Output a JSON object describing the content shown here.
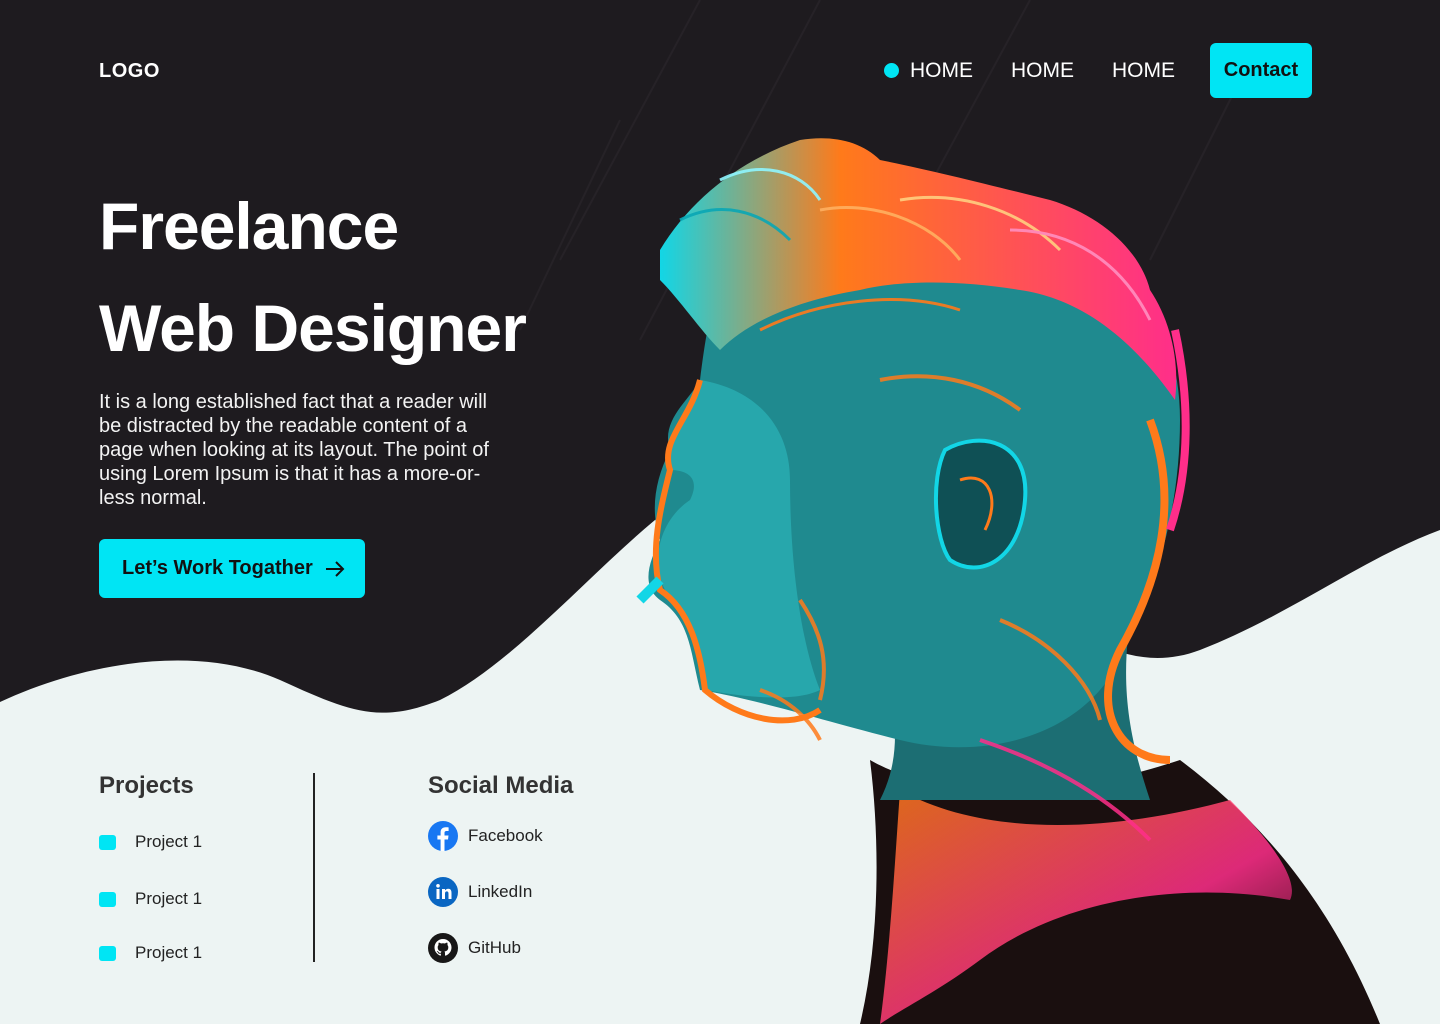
{
  "header": {
    "logo": "LOGO",
    "nav": [
      "HOME",
      "HOME",
      "HOME"
    ],
    "contact_label": "Contact"
  },
  "hero": {
    "title_line1": "Freelance",
    "title_line2": "Web Designer",
    "description": "It is a long established fact that a reader will be distracted by the readable content of a page when looking at its layout. The point of using Lorem Ipsum is that it has a more-or-less normal.",
    "cta_label": "Let’s Work Togather"
  },
  "projects": {
    "title": "Projects",
    "items": [
      "Project 1",
      "Project 1",
      "Project 1"
    ]
  },
  "social": {
    "title": "Social Media",
    "items": [
      {
        "label": "Facebook",
        "icon": "facebook-icon"
      },
      {
        "label": "LinkedIn",
        "icon": "linkedin-icon"
      },
      {
        "label": "GitHub",
        "icon": "github-icon"
      }
    ]
  },
  "colors": {
    "accent": "#00e5f4",
    "dark": "#1e1b1f",
    "light": "#edf4f3",
    "orange": "#ff7a1a",
    "pink": "#ff2e8a",
    "teal": "#1f8a8f"
  }
}
